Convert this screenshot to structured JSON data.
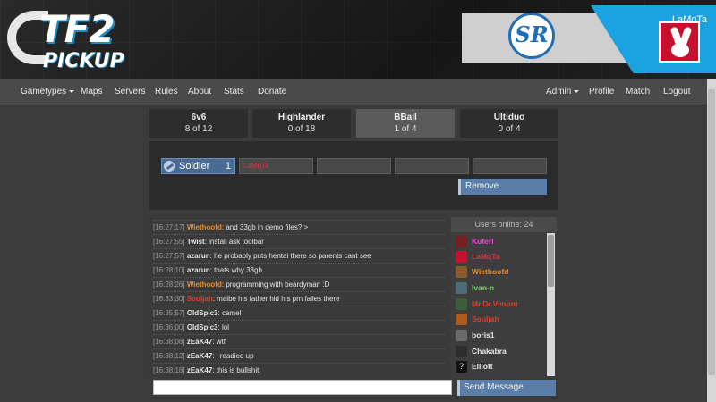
{
  "header": {
    "logo_top": "TF2",
    "logo_bottom": "PICKUP",
    "partner_logo": "SR",
    "username": "LaMqTa"
  },
  "nav": {
    "left": [
      "Gametypes",
      "Maps",
      "Servers",
      "Rules",
      "About",
      "Stats",
      "Donate"
    ],
    "right": [
      "Admin",
      "Profile",
      "Match",
      "Logout"
    ]
  },
  "gametypes": [
    {
      "name": "6v6",
      "count": "8 of 12"
    },
    {
      "name": "Highlander",
      "count": "0 of 18"
    },
    {
      "name": "BBall",
      "count": "1 of 4"
    },
    {
      "name": "Ultiduo",
      "count": "0 of 4"
    }
  ],
  "class_row": {
    "class_name": "Soldier",
    "class_count": "1",
    "slots": [
      "LaMqTa",
      "",
      "",
      "",
      ""
    ],
    "remove_label": "Remove"
  },
  "chat": [
    {
      "time": "[16:27:17]",
      "user": "Wiethoofd",
      "user_color": "#f08a24",
      "msg": "and 33gb in demo files? >"
    },
    {
      "time": "[16:27:55]",
      "user": "Twist",
      "user_color": "#e6e6e6",
      "msg": "install ask toolbar"
    },
    {
      "time": "[16:27:57]",
      "user": "azarun",
      "user_color": "#e6e6e6",
      "msg": "he probably puts hentai there so parents cant see"
    },
    {
      "time": "[16:28:10]",
      "user": "azarun",
      "user_color": "#e6e6e6",
      "msg": "thats why 33gb"
    },
    {
      "time": "[16:28:26]",
      "user": "Wiethoofd",
      "user_color": "#f08a24",
      "msg": "programming with beardyman :D"
    },
    {
      "time": "[16:33:30]",
      "user": "Souljah",
      "user_color": "#d9432f",
      "msg": "maibe his father hid his prn failes there"
    },
    {
      "time": "[16:35:57]",
      "user": "OldSpic3",
      "user_color": "#e6e6e6",
      "msg": "camel"
    },
    {
      "time": "[16:36:00]",
      "user": "OldSpic3",
      "user_color": "#e6e6e6",
      "msg": "lol"
    },
    {
      "time": "[16:38:08]",
      "user": "zEaK47",
      "user_color": "#e6e6e6",
      "msg": "wtf"
    },
    {
      "time": "[16:38:12]",
      "user": "zEaK47",
      "user_color": "#e6e6e6",
      "msg": "i readied up"
    },
    {
      "time": "[16:38:18]",
      "user": "zEaK47",
      "user_color": "#e6e6e6",
      "msg": "this is bullshit"
    }
  ],
  "users_online": {
    "header": "Users online: 24",
    "users": [
      {
        "name": "Kuferl",
        "color": "#e44dd6",
        "icon_color": "#7a1f1f"
      },
      {
        "name": "LaMqTa",
        "color": "#e0324b",
        "icon_color": "#c8102e"
      },
      {
        "name": "Wiethoofd",
        "color": "#f08a24",
        "icon_color": "#8a5a2a"
      },
      {
        "name": "Ivan-n",
        "color": "#7fd67f",
        "icon_color": "#4e6b7a"
      },
      {
        "name": "Mr.Dr.Venom",
        "color": "#d9432f",
        "icon_color": "#3a5f3a"
      },
      {
        "name": "Souljah",
        "color": "#d9432f",
        "icon_color": "#b05a1a"
      },
      {
        "name": "boris1",
        "color": "#e6e6e6",
        "icon_color": "#6a6a6a"
      },
      {
        "name": "Chakabra",
        "color": "#e6e6e6",
        "icon_color": "#2d2d2d"
      },
      {
        "name": "Elliott",
        "color": "#e6e6e6",
        "icon_color": "#111111",
        "icon_glyph": "?"
      }
    ]
  },
  "composer": {
    "input_value": "",
    "send_label": "Send Message"
  },
  "colors": {
    "accent_blue": "#1aa3e0",
    "button_blue": "#5b7ea8"
  }
}
